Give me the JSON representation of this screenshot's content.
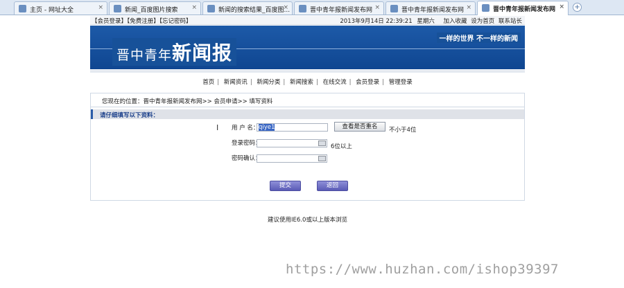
{
  "tabs": [
    {
      "label": "主页 - 网址大全",
      "active": false
    },
    {
      "label": "新闻_百度图片搜索",
      "active": false
    },
    {
      "label": "新闻的搜索结果_百度图...",
      "active": false
    },
    {
      "label": "晋中青年报新闻发布网",
      "active": false
    },
    {
      "label": "晋中青年报新闻发布网",
      "active": false
    },
    {
      "label": "晋中青年报新闻发布网",
      "active": true
    }
  ],
  "topbar": {
    "links": "【会员登录】【免费注册】【忘记密码】",
    "datetime": "2013年9月14日 22:39:21",
    "weekday": "星期六",
    "favorite": "加入收藏",
    "homepage": "设为首页",
    "contact": "联系站长"
  },
  "banner": {
    "title_small": "晋中青年",
    "title_big": "新闻报",
    "slogan": "一样的世界 不一样的新闻",
    "color": "#175199"
  },
  "nav": [
    "首页",
    "新闻资讯",
    "新闻分类",
    "新闻搜索",
    "在线交流",
    "会员登录",
    "管理登录"
  ],
  "breadcrumb": "您现在的位置：晋中青年报新闻发布网>> 会员申请>> 填写资料",
  "form": {
    "header": "请仔细填写以下资料：",
    "username_label": "用 户 名：",
    "username_value": "qiye1",
    "check_button": "查看是否重名",
    "username_hint": "不小于4位",
    "password_label": "登录密码：",
    "password_hint": "6位以上",
    "confirm_label": "密码确认：",
    "submit": "提交",
    "back": "返回"
  },
  "footer": "建议使用IE6.0或以上版本浏览",
  "watermark": "https://www.huzhan.com/ishop39397"
}
